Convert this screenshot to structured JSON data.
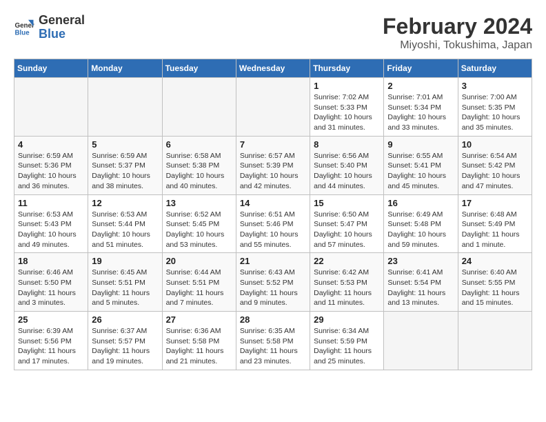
{
  "logo": {
    "line1": "General",
    "line2": "Blue"
  },
  "title": "February 2024",
  "location": "Miyoshi, Tokushima, Japan",
  "days_header": [
    "Sunday",
    "Monday",
    "Tuesday",
    "Wednesday",
    "Thursday",
    "Friday",
    "Saturday"
  ],
  "weeks": [
    [
      {
        "num": "",
        "info": ""
      },
      {
        "num": "",
        "info": ""
      },
      {
        "num": "",
        "info": ""
      },
      {
        "num": "",
        "info": ""
      },
      {
        "num": "1",
        "info": "Sunrise: 7:02 AM\nSunset: 5:33 PM\nDaylight: 10 hours\nand 31 minutes."
      },
      {
        "num": "2",
        "info": "Sunrise: 7:01 AM\nSunset: 5:34 PM\nDaylight: 10 hours\nand 33 minutes."
      },
      {
        "num": "3",
        "info": "Sunrise: 7:00 AM\nSunset: 5:35 PM\nDaylight: 10 hours\nand 35 minutes."
      }
    ],
    [
      {
        "num": "4",
        "info": "Sunrise: 6:59 AM\nSunset: 5:36 PM\nDaylight: 10 hours\nand 36 minutes."
      },
      {
        "num": "5",
        "info": "Sunrise: 6:59 AM\nSunset: 5:37 PM\nDaylight: 10 hours\nand 38 minutes."
      },
      {
        "num": "6",
        "info": "Sunrise: 6:58 AM\nSunset: 5:38 PM\nDaylight: 10 hours\nand 40 minutes."
      },
      {
        "num": "7",
        "info": "Sunrise: 6:57 AM\nSunset: 5:39 PM\nDaylight: 10 hours\nand 42 minutes."
      },
      {
        "num": "8",
        "info": "Sunrise: 6:56 AM\nSunset: 5:40 PM\nDaylight: 10 hours\nand 44 minutes."
      },
      {
        "num": "9",
        "info": "Sunrise: 6:55 AM\nSunset: 5:41 PM\nDaylight: 10 hours\nand 45 minutes."
      },
      {
        "num": "10",
        "info": "Sunrise: 6:54 AM\nSunset: 5:42 PM\nDaylight: 10 hours\nand 47 minutes."
      }
    ],
    [
      {
        "num": "11",
        "info": "Sunrise: 6:53 AM\nSunset: 5:43 PM\nDaylight: 10 hours\nand 49 minutes."
      },
      {
        "num": "12",
        "info": "Sunrise: 6:53 AM\nSunset: 5:44 PM\nDaylight: 10 hours\nand 51 minutes."
      },
      {
        "num": "13",
        "info": "Sunrise: 6:52 AM\nSunset: 5:45 PM\nDaylight: 10 hours\nand 53 minutes."
      },
      {
        "num": "14",
        "info": "Sunrise: 6:51 AM\nSunset: 5:46 PM\nDaylight: 10 hours\nand 55 minutes."
      },
      {
        "num": "15",
        "info": "Sunrise: 6:50 AM\nSunset: 5:47 PM\nDaylight: 10 hours\nand 57 minutes."
      },
      {
        "num": "16",
        "info": "Sunrise: 6:49 AM\nSunset: 5:48 PM\nDaylight: 10 hours\nand 59 minutes."
      },
      {
        "num": "17",
        "info": "Sunrise: 6:48 AM\nSunset: 5:49 PM\nDaylight: 11 hours\nand 1 minute."
      }
    ],
    [
      {
        "num": "18",
        "info": "Sunrise: 6:46 AM\nSunset: 5:50 PM\nDaylight: 11 hours\nand 3 minutes."
      },
      {
        "num": "19",
        "info": "Sunrise: 6:45 AM\nSunset: 5:51 PM\nDaylight: 11 hours\nand 5 minutes."
      },
      {
        "num": "20",
        "info": "Sunrise: 6:44 AM\nSunset: 5:51 PM\nDaylight: 11 hours\nand 7 minutes."
      },
      {
        "num": "21",
        "info": "Sunrise: 6:43 AM\nSunset: 5:52 PM\nDaylight: 11 hours\nand 9 minutes."
      },
      {
        "num": "22",
        "info": "Sunrise: 6:42 AM\nSunset: 5:53 PM\nDaylight: 11 hours\nand 11 minutes."
      },
      {
        "num": "23",
        "info": "Sunrise: 6:41 AM\nSunset: 5:54 PM\nDaylight: 11 hours\nand 13 minutes."
      },
      {
        "num": "24",
        "info": "Sunrise: 6:40 AM\nSunset: 5:55 PM\nDaylight: 11 hours\nand 15 minutes."
      }
    ],
    [
      {
        "num": "25",
        "info": "Sunrise: 6:39 AM\nSunset: 5:56 PM\nDaylight: 11 hours\nand 17 minutes."
      },
      {
        "num": "26",
        "info": "Sunrise: 6:37 AM\nSunset: 5:57 PM\nDaylight: 11 hours\nand 19 minutes."
      },
      {
        "num": "27",
        "info": "Sunrise: 6:36 AM\nSunset: 5:58 PM\nDaylight: 11 hours\nand 21 minutes."
      },
      {
        "num": "28",
        "info": "Sunrise: 6:35 AM\nSunset: 5:58 PM\nDaylight: 11 hours\nand 23 minutes."
      },
      {
        "num": "29",
        "info": "Sunrise: 6:34 AM\nSunset: 5:59 PM\nDaylight: 11 hours\nand 25 minutes."
      },
      {
        "num": "",
        "info": ""
      },
      {
        "num": "",
        "info": ""
      }
    ]
  ]
}
